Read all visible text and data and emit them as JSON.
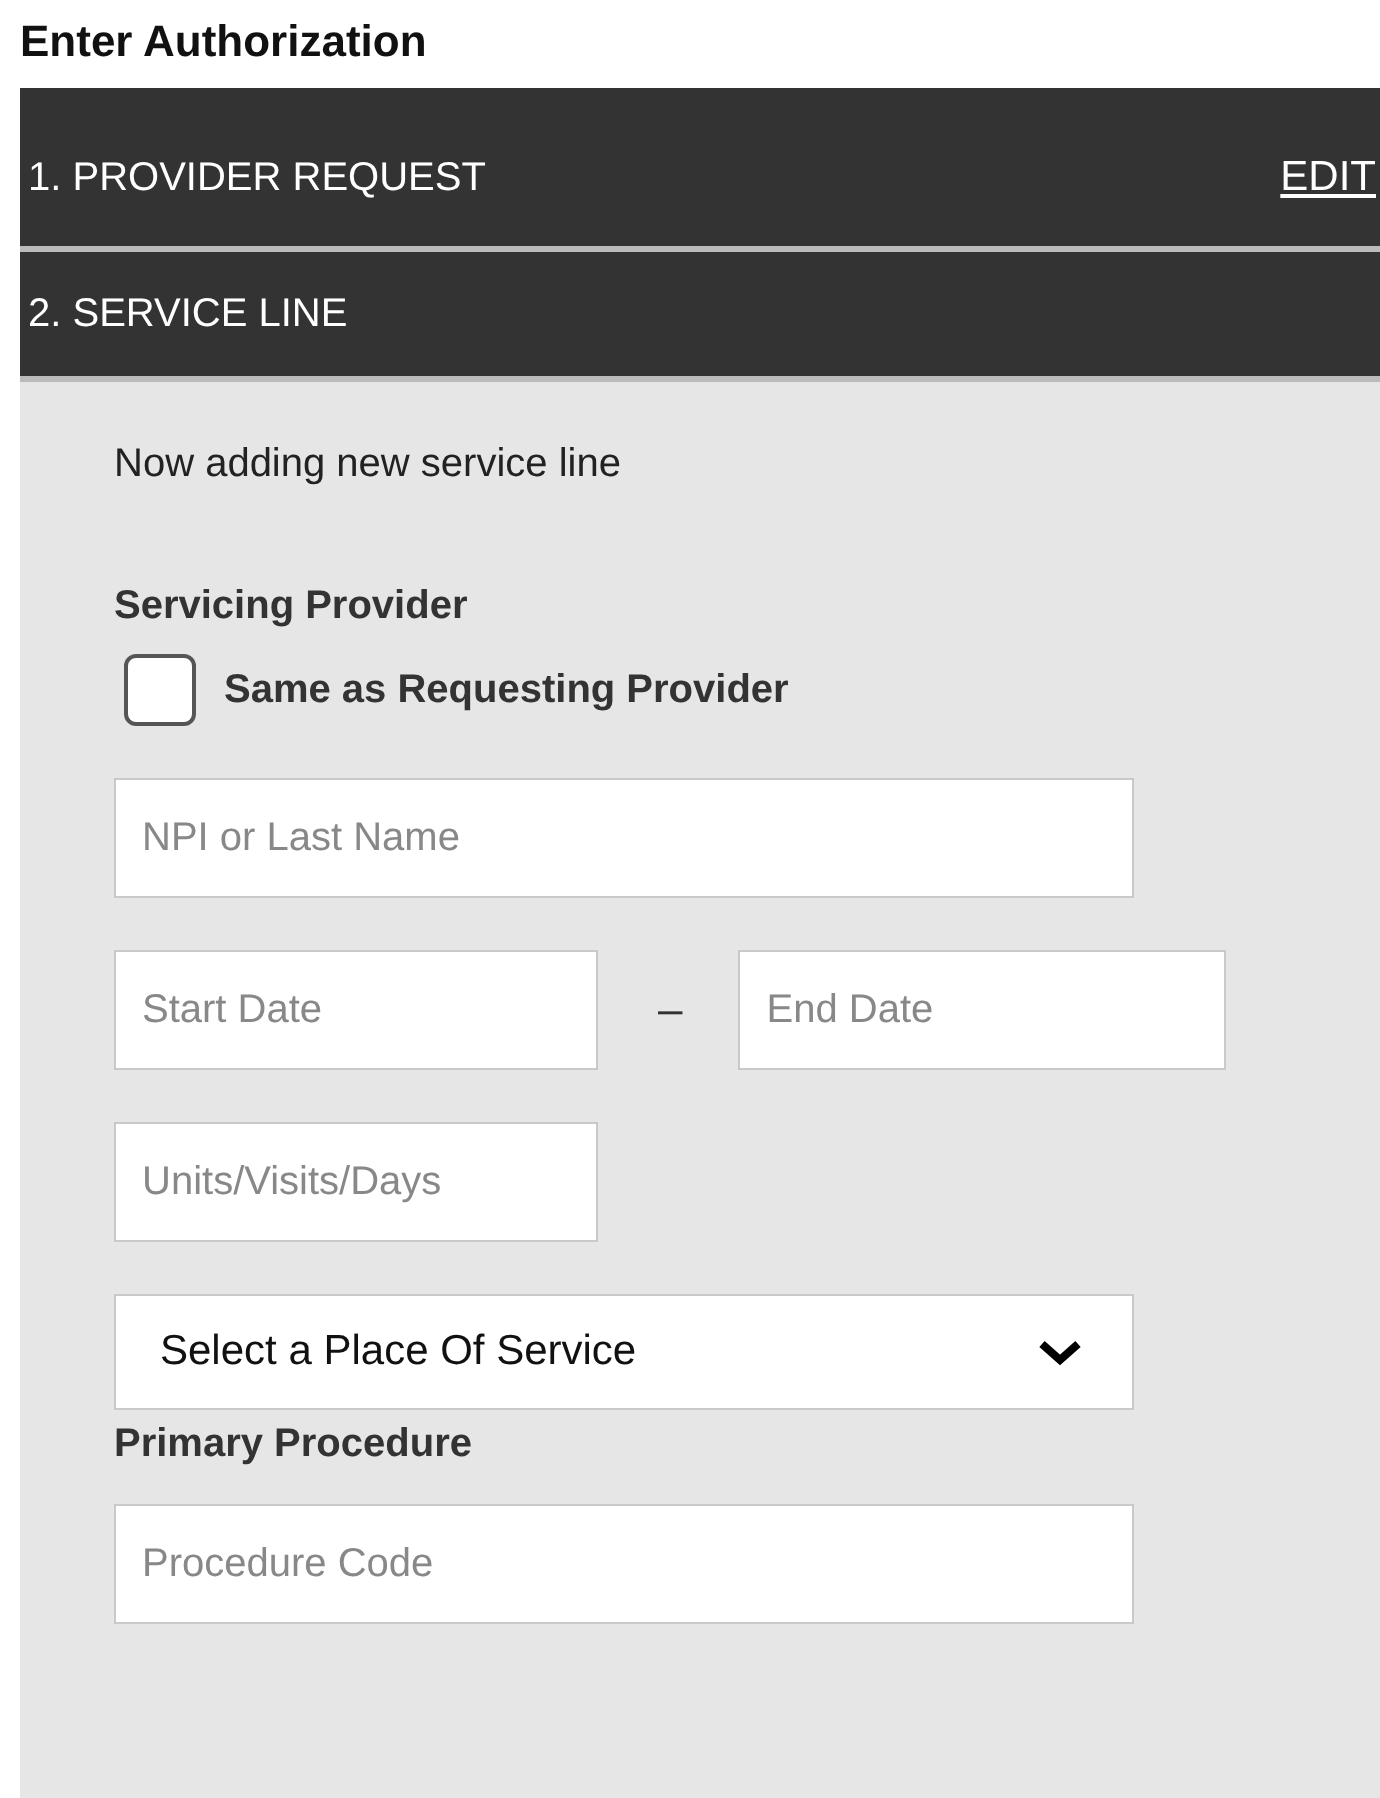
{
  "page_title": "Enter Authorization",
  "sections": [
    {
      "label": "1. PROVIDER REQUEST",
      "action": "EDIT"
    },
    {
      "label": "2. SERVICE LINE"
    }
  ],
  "service_line": {
    "status": "Now adding new service line",
    "servicing_provider": {
      "label": "Servicing Provider",
      "same_as_requesting": {
        "label": "Same as Requesting Provider",
        "checked": false
      }
    },
    "provider_search": {
      "placeholder": "NPI or Last Name"
    },
    "start_date": {
      "placeholder": "Start Date"
    },
    "date_separator": "–",
    "end_date": {
      "placeholder": "End Date"
    },
    "units": {
      "placeholder": "Units/Visits/Days"
    },
    "place_of_service": {
      "value": "Select a Place Of Service"
    },
    "primary_procedure": {
      "label": "Primary Procedure",
      "placeholder": "Procedure Code"
    }
  }
}
